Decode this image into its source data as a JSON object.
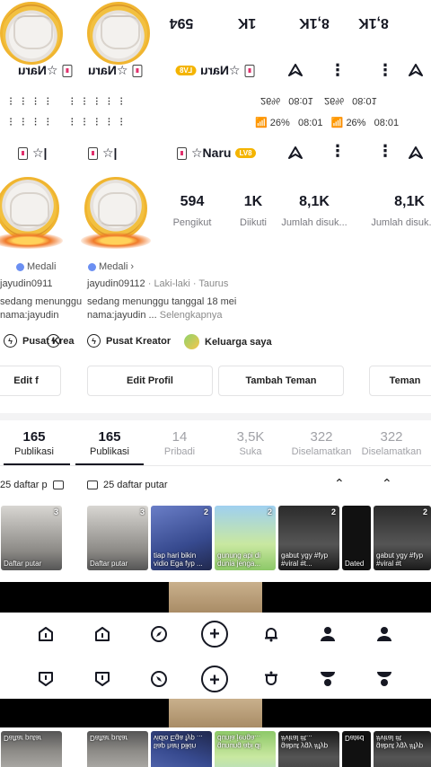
{
  "profile": {
    "name_prefix": "☆Naru",
    "level_badge": "LV8",
    "following_short": "1K",
    "stats": [
      {
        "value": "594",
        "label": "Pengikut"
      },
      {
        "value": "1K",
        "label": "Diikuti"
      },
      {
        "value": "8,1K",
        "label": "Jumlah disuk..."
      }
    ],
    "stats_right_partial": {
      "value": "8,1K",
      "label": "Jumlah disuk..."
    },
    "top_mirror_stats": [
      "594",
      "1K",
      "8,1K",
      "8,1K"
    ],
    "top_mirror_labels": [
      "Pengikut",
      "Diikuti",
      "Jumlah disuk",
      "Jumlah disuk"
    ],
    "medal_label": "Medali",
    "username_line": "jayudin09112",
    "gender": "Laki-laki",
    "zodiac": "Taurus",
    "bio_line1": "sedang menunggu tanggal 18 mei",
    "bio_line2": "nama:jayudin",
    "see_more": "Selengkapnya",
    "left_bio1": "sedang menunggu",
    "left_bio2": "nama:jayudin",
    "left_user": "jayudin0911",
    "creator_center": "Pusat Kreator",
    "creator_center_short": "Pusat Krea",
    "family": "Keluarga saya"
  },
  "statusbar": {
    "time": "08:01",
    "battery": "26%",
    "battery_mirror": "26%"
  },
  "buttons": {
    "edit_profile": "Edit Profil",
    "edit_profile_short": "Edit f",
    "add_friend": "Tambah Teman",
    "add_friend_short": "Teman"
  },
  "tabs": [
    {
      "value": "165",
      "label": "Publikasi"
    },
    {
      "value": "14",
      "label": "Pribadi"
    },
    {
      "value": "3,5K",
      "label": "Suka"
    },
    {
      "value": "322",
      "label": "Diselamatkan"
    }
  ],
  "tab_left_partial": {
    "value": "165",
    "label": "Publikasi"
  },
  "tab_right_partial": {
    "value": "322",
    "label": "Diselamatkan"
  },
  "playlist": {
    "count_label": "25 daftar putar",
    "count_label_short": "25 daftar p"
  },
  "thumbnails": [
    {
      "caption": "Daftar putar",
      "count": "3"
    },
    {
      "caption": "Daftar putar",
      "count": "3"
    },
    {
      "caption": "tiap hari bikin vidio Ega fyp ...",
      "count": "2"
    },
    {
      "caption": "gunung api di dunia jenga...",
      "count": "2"
    },
    {
      "caption": "gabut ygy #fyp #viral #t...",
      "count": "2"
    },
    {
      "caption": "Dated",
      "count": ""
    },
    {
      "caption": "gabut ygy #fyp #viral #t",
      "count": "2"
    }
  ],
  "colors": {
    "accent": "#f4b400",
    "text": "#161823",
    "muted": "#7a7a80"
  },
  "icons": [
    "home-icon",
    "friends-icon",
    "discover-icon",
    "plus-icon",
    "inbox-icon",
    "profile-icon",
    "profile-icon-2"
  ]
}
